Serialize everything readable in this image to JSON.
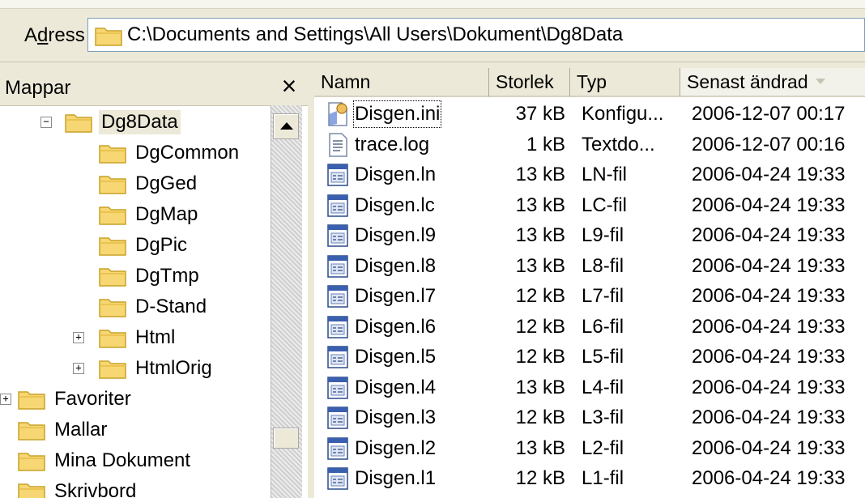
{
  "address": {
    "label_pre": "A",
    "label_ul": "d",
    "label_post": "ress",
    "path": "C:\\Documents and Settings\\All Users\\Dokument\\Dg8Data"
  },
  "folders": {
    "title": "Mappar",
    "close": "×",
    "items": [
      {
        "label": "Dg8Data"
      },
      {
        "label": "DgCommon"
      },
      {
        "label": "DgGed"
      },
      {
        "label": "DgMap"
      },
      {
        "label": "DgPic"
      },
      {
        "label": "DgTmp"
      },
      {
        "label": "D-Stand"
      },
      {
        "label": "Html"
      },
      {
        "label": "HtmlOrig"
      },
      {
        "label": "Favoriter"
      },
      {
        "label": "Mallar"
      },
      {
        "label": "Mina Dokument"
      },
      {
        "label": "Skrivbord"
      }
    ]
  },
  "list": {
    "columns": {
      "name": "Namn",
      "size": "Storlek",
      "type": "Typ",
      "date": "Senast ändrad"
    },
    "rows": [
      {
        "name": "Disgen.ini",
        "size": "37 kB",
        "type": "Konfigu...",
        "date": "2006-12-07 00:17",
        "icon": "settings-file-icon"
      },
      {
        "name": "trace.log",
        "size": "1 kB",
        "type": "Textdo...",
        "date": "2006-12-07 00:16",
        "icon": "text-file-icon"
      },
      {
        "name": "Disgen.ln",
        "size": "13 kB",
        "type": "LN-fil",
        "date": "2006-04-24 19:33",
        "icon": "generic-file-icon"
      },
      {
        "name": "Disgen.lc",
        "size": "13 kB",
        "type": "LC-fil",
        "date": "2006-04-24 19:33",
        "icon": "generic-file-icon"
      },
      {
        "name": "Disgen.l9",
        "size": "13 kB",
        "type": "L9-fil",
        "date": "2006-04-24 19:33",
        "icon": "generic-file-icon"
      },
      {
        "name": "Disgen.l8",
        "size": "13 kB",
        "type": "L8-fil",
        "date": "2006-04-24 19:33",
        "icon": "generic-file-icon"
      },
      {
        "name": "Disgen.l7",
        "size": "12 kB",
        "type": "L7-fil",
        "date": "2006-04-24 19:33",
        "icon": "generic-file-icon"
      },
      {
        "name": "Disgen.l6",
        "size": "12 kB",
        "type": "L6-fil",
        "date": "2006-04-24 19:33",
        "icon": "generic-file-icon"
      },
      {
        "name": "Disgen.l5",
        "size": "12 kB",
        "type": "L5-fil",
        "date": "2006-04-24 19:33",
        "icon": "generic-file-icon"
      },
      {
        "name": "Disgen.l4",
        "size": "13 kB",
        "type": "L4-fil",
        "date": "2006-04-24 19:33",
        "icon": "generic-file-icon"
      },
      {
        "name": "Disgen.l3",
        "size": "12 kB",
        "type": "L3-fil",
        "date": "2006-04-24 19:33",
        "icon": "generic-file-icon"
      },
      {
        "name": "Disgen.l2",
        "size": "13 kB",
        "type": "L2-fil",
        "date": "2006-04-24 19:33",
        "icon": "generic-file-icon"
      },
      {
        "name": "Disgen.l1",
        "size": "12 kB",
        "type": "L1-fil",
        "date": "2006-04-24 19:33",
        "icon": "generic-file-icon"
      }
    ]
  },
  "colors": {
    "folder": "#f7d774",
    "folder_edge": "#c9a227",
    "selection": "#ece9d8",
    "address_border": "#7f9db9"
  }
}
